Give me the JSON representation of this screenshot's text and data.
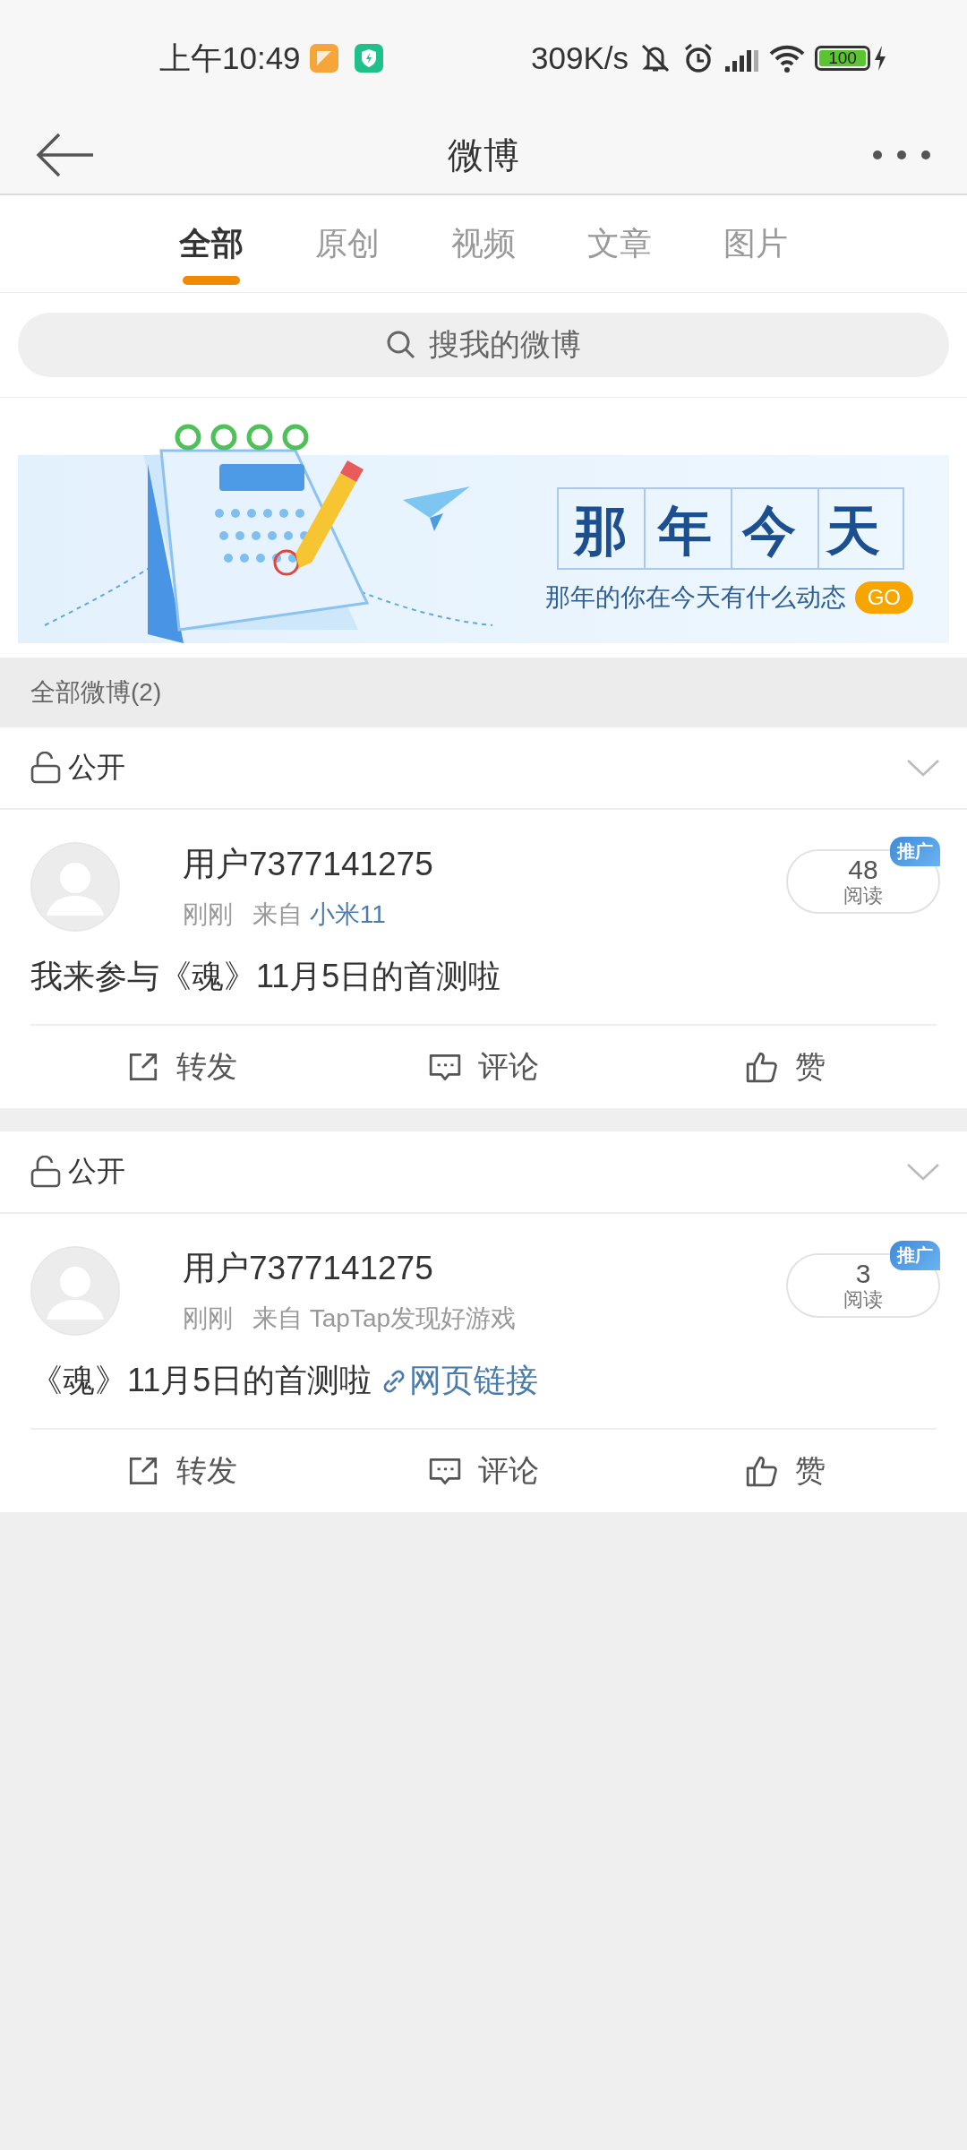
{
  "status_bar": {
    "time": "上午10:49",
    "net_speed": "309K/s",
    "battery": "100"
  },
  "app_bar": {
    "title": "微博"
  },
  "tabs": [
    {
      "label": "全部",
      "selected": true
    },
    {
      "label": "原创",
      "selected": false
    },
    {
      "label": "视频",
      "selected": false
    },
    {
      "label": "文章",
      "selected": false
    },
    {
      "label": "图片",
      "selected": false
    }
  ],
  "search": {
    "placeholder": "搜我的微博"
  },
  "banner": {
    "title": "那年今天",
    "subtitle": "那年的你在今天有什么动态",
    "button": "GO"
  },
  "section_header": "全部微博(2)",
  "posts": [
    {
      "privacy": "公开",
      "user": "用户7377141275",
      "time": "刚刚",
      "source_prefix": "来自",
      "source": "小米11",
      "source_link": true,
      "reads": "48",
      "reads_label": "阅读",
      "badge": "推广",
      "content": "我来参与《魂》11月5日的首测啦",
      "actions": [
        {
          "kind": "repost",
          "label": "转发"
        },
        {
          "kind": "comment",
          "label": "评论"
        },
        {
          "kind": "like",
          "label": "赞"
        }
      ]
    },
    {
      "privacy": "公开",
      "user": "用户7377141275",
      "time": "刚刚",
      "source_prefix": "来自",
      "source": "TapTap发现好游戏",
      "source_link": false,
      "reads": "3",
      "reads_label": "阅读",
      "badge": "推广",
      "content": "《魂》11月5日的首测啦",
      "link": "网页链接",
      "actions": [
        {
          "kind": "repost",
          "label": "转发"
        },
        {
          "kind": "comment",
          "label": "评论"
        },
        {
          "kind": "like",
          "label": "赞"
        }
      ]
    }
  ]
}
